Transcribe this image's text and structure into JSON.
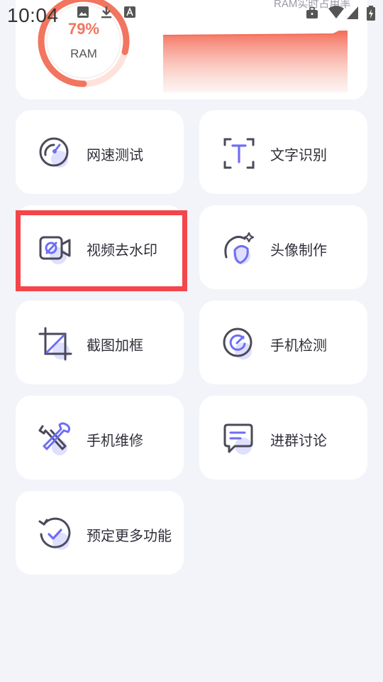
{
  "status_bar": {
    "time": "10:04",
    "icons": [
      "image-icon",
      "download-icon",
      "accessibility-icon"
    ],
    "right_icons": [
      "briefcase-icon",
      "wifi-icon",
      "cellular-icon",
      "battery-charging-icon"
    ]
  },
  "ram": {
    "caption": "RAM实时占用率",
    "percent_text": "79%",
    "percent_value": 0.79,
    "label": "RAM"
  },
  "colors": {
    "accent": "#f2755f",
    "gauge_track": "#fde3dc",
    "icon_stroke": "#4a4a5a",
    "icon_blob": "#dfe0ff",
    "highlight": "#f4454a",
    "card_bg": "#ffffff",
    "page_bg": "#f3f4f9"
  },
  "tools": [
    {
      "label": "网速测试",
      "icon": "speedometer-icon"
    },
    {
      "label": "文字识别",
      "icon": "text-scan-icon"
    },
    {
      "label": "视频去水印",
      "icon": "video-watermark-icon"
    },
    {
      "label": "头像制作",
      "icon": "avatar-maker-icon"
    },
    {
      "label": "截图加框",
      "icon": "crop-frame-icon"
    },
    {
      "label": "手机检测",
      "icon": "phone-check-icon"
    },
    {
      "label": "手机维修",
      "icon": "repair-tools-icon"
    },
    {
      "label": "进群讨论",
      "icon": "chat-group-icon"
    },
    {
      "label": "预定更多功能",
      "icon": "reserve-features-icon"
    }
  ]
}
